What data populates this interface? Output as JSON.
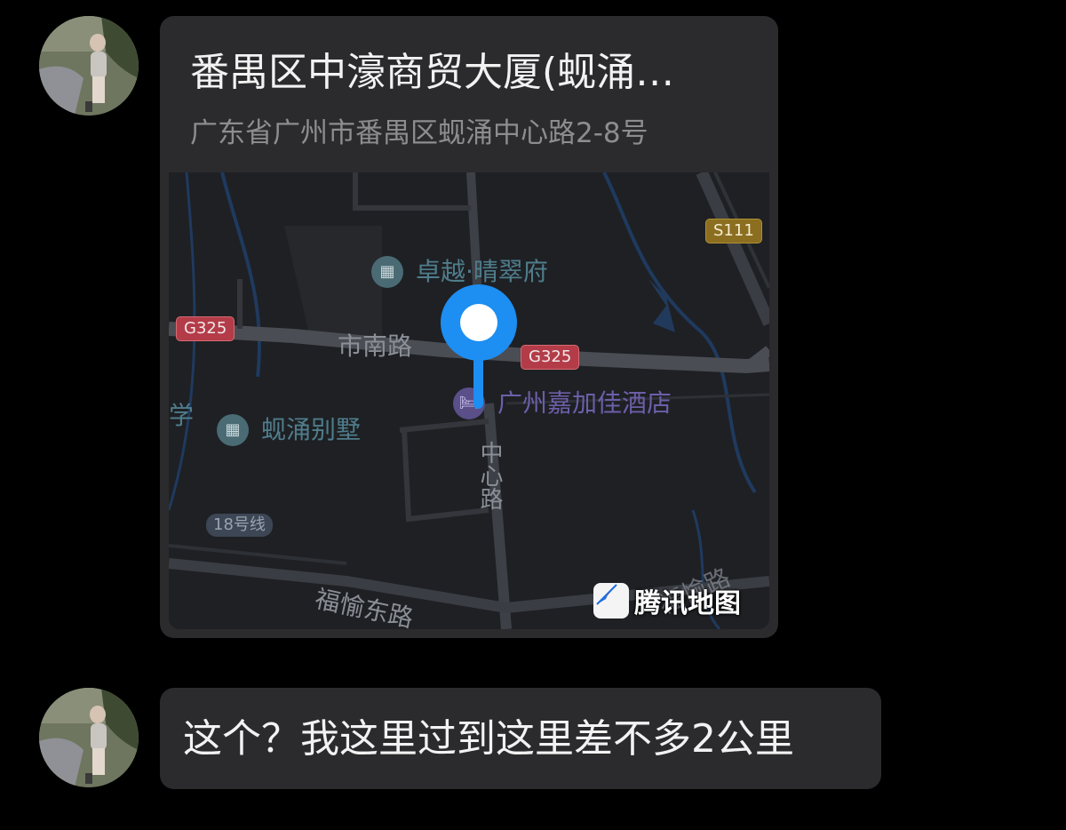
{
  "messages": [
    {
      "type": "location",
      "title": "番禺区中濠商贸大厦(蚬涌…",
      "address": "广东省广州市番禺区蚬涌中心路2-8号",
      "map": {
        "provider": "腾讯地图",
        "pois": [
          "卓越·晴翠府",
          "蚬涌别墅",
          "学"
        ],
        "hotel": "广州嘉加佳酒店",
        "roads": [
          "市南路",
          "中心路",
          "福愉东路",
          "福愉路"
        ],
        "badges": [
          "G325",
          "G325",
          "S111"
        ],
        "metro": "18号线"
      }
    },
    {
      "type": "text",
      "text": "这个？我这里过到这里差不多2公里"
    }
  ],
  "colors": {
    "background": "#000000",
    "bubble": "#2b2b2d",
    "pin": "#1d8ef2"
  },
  "icons": [
    "avatar",
    "building-poi-icon",
    "hotel-bed-icon",
    "location-pin-icon",
    "tencent-map-logo-icon"
  ]
}
